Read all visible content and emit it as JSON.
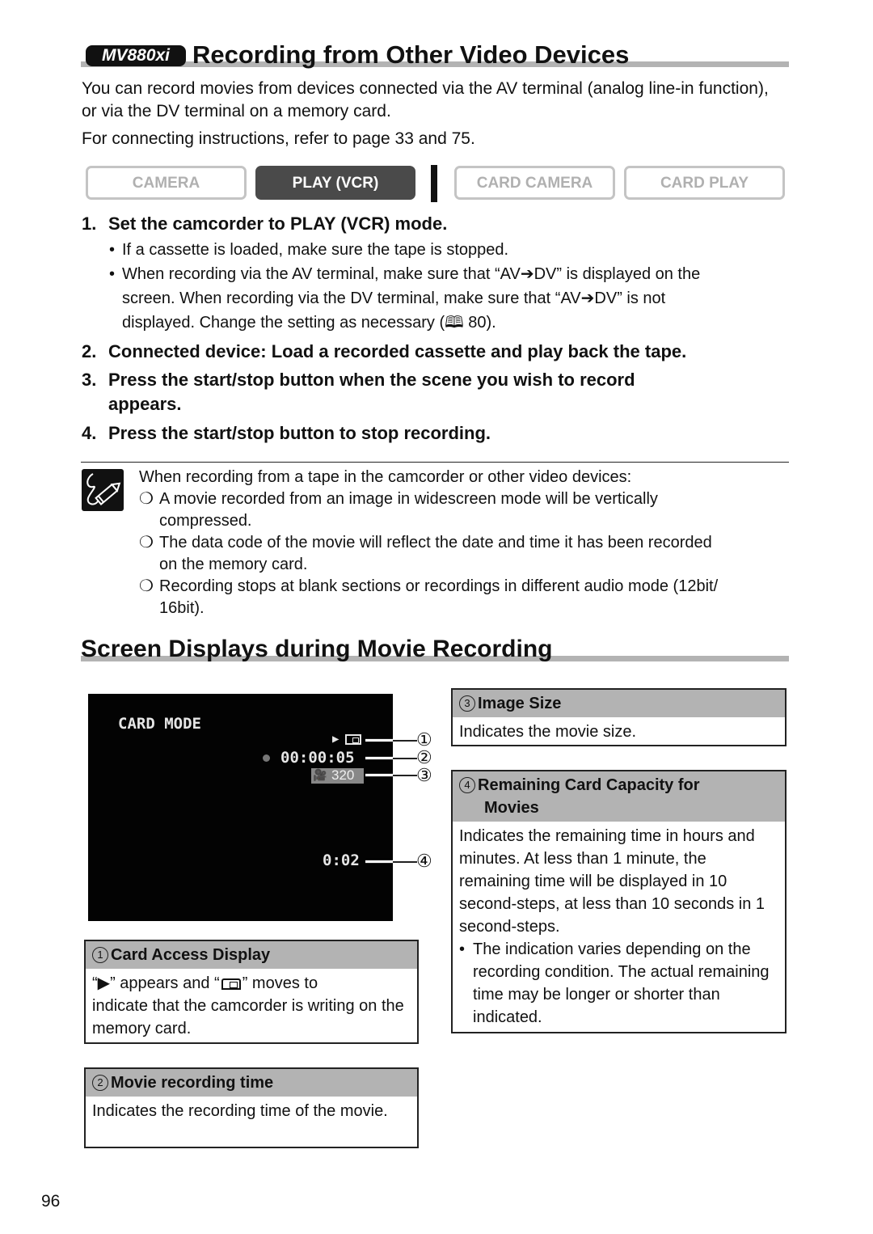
{
  "section1": {
    "model_badge": "MV880xi",
    "title": "Recording from Other Video Devices",
    "intro": "You can record movies from devices connected via the AV terminal (analog line-in function), or via the DV terminal on a memory card.",
    "connect_ref": "For connecting instructions, refer to page 33 and 75."
  },
  "modes": [
    {
      "label": "CAMERA",
      "active": false
    },
    {
      "label": "PLAY (VCR)",
      "active": true
    },
    {
      "label": "CARD CAMERA",
      "active": false
    },
    {
      "label": "CARD PLAY",
      "active": false
    }
  ],
  "steps": [
    {
      "num": "1.",
      "text": "Set the camcorder to PLAY (VCR) mode."
    },
    {
      "num": "2.",
      "text": "Connected device: Load a recorded cassette and play back the tape."
    },
    {
      "num": "3.",
      "text": "Press the start/stop button when the scene you wish to record",
      "text2": "appears."
    },
    {
      "num": "4.",
      "text": "Press the start/stop button to stop recording."
    }
  ],
  "step1_bullets": [
    {
      "text": "If a cassette is loaded, make sure the tape is stopped."
    },
    {
      "line1": "When recording via the AV terminal, make sure that “AV➔DV” is displayed on the",
      "line2": "screen. When recording via the DV terminal, make sure that “AV➔DV” is not",
      "line3": "displayed. Change the setting as necessary (🕮 80)."
    }
  ],
  "note": {
    "icon": "pencil-note-icon",
    "lead": "When recording from a tape in the camcorder or other video devices:",
    "bullet_glyph": "❍",
    "items": [
      {
        "l1": "A movie recorded from an image in widescreen mode will be vertically",
        "l2": "compressed."
      },
      {
        "l1": "The data code of the movie will reflect the date and time it has been recorded",
        "l2": "on the memory card."
      },
      {
        "l1": "Recording stops at blank sections or recordings in different audio mode (12bit/",
        "l2": "16bit)."
      }
    ]
  },
  "section2": {
    "title": "Screen Displays during Movie Recording"
  },
  "screen": {
    "mode_label": "CARD MODE",
    "access_glyph": "▶",
    "rec_time": "00:00:05",
    "image_size": "320",
    "remaining": "0:02",
    "callouts": [
      "①",
      "②",
      "③",
      "④"
    ]
  },
  "boxes": {
    "card_access": {
      "num": "1",
      "title": "Card Access Display",
      "body_pre": "“",
      "body_play": "▶",
      "body_mid": "” appears and “",
      "body_post": "” moves to",
      "body_rest": "indicate that the camcorder is writing on the memory card."
    },
    "rec_time": {
      "num": "2",
      "title": "Movie recording time",
      "body": "Indicates the recording time of the movie."
    },
    "image_size": {
      "num": "3",
      "title": "Image Size",
      "body": "Indicates the movie size."
    },
    "remaining": {
      "num": "4",
      "title": "Remaining Card Capacity for",
      "title2": "Movies",
      "body": "Indicates the remaining time in hours and minutes. At less than 1 minute, the remaining time will be displayed in 10 second-steps, at less than 10 seconds in 1 second-steps.",
      "bullet": "The indication varies depending on the recording condition. The actual remaining time may be longer or shorter than indicated."
    }
  },
  "page_number": "96"
}
